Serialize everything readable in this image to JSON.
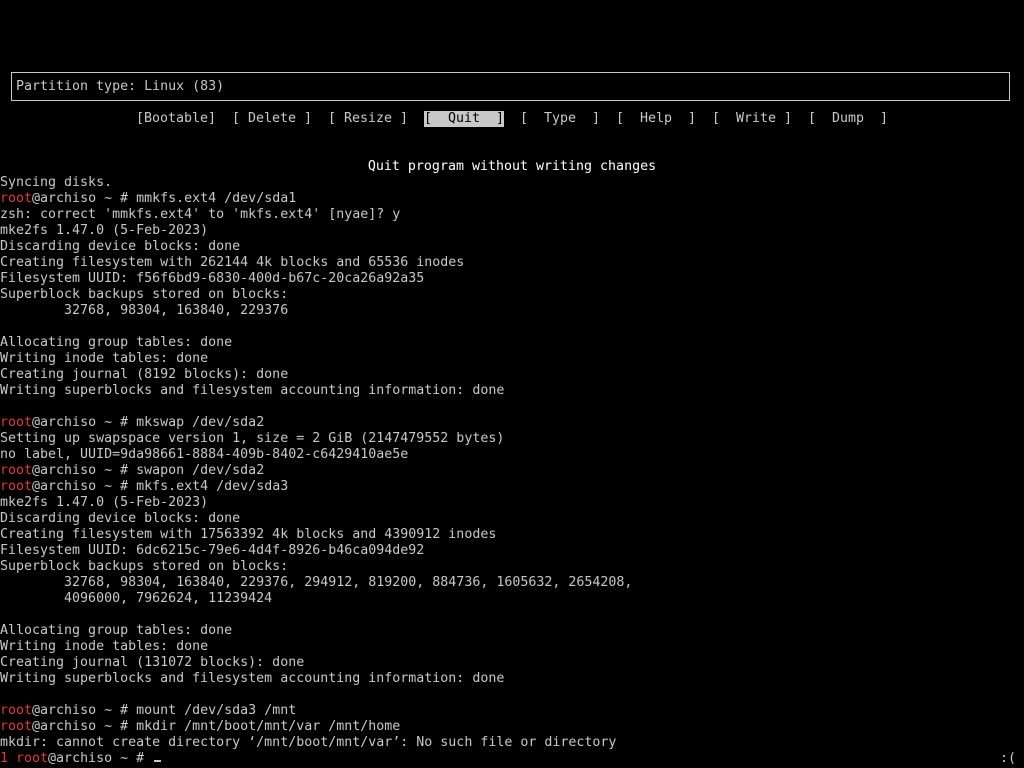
{
  "partition_box": {
    "text": "Partition type: Linux (83)"
  },
  "menu": {
    "items": [
      {
        "label": "[Bootable]"
      },
      {
        "label": "[ Delete ]"
      },
      {
        "label": "[ Resize ]"
      },
      {
        "label": "[  Quit  ]",
        "selected": true
      },
      {
        "label": "[  Type  ]"
      },
      {
        "label": "[  Help  ]"
      },
      {
        "label": "[  Write ]"
      },
      {
        "label": "[  Dump  ]"
      }
    ],
    "hint": "Quit program without writing changes"
  },
  "terminal": {
    "prompt_user": "root",
    "prompt_host": "@archiso ~ # ",
    "lines": [
      {
        "text": "Syncing disks."
      },
      {
        "prompt": true,
        "cmd": "mmkfs.ext4 /dev/sda1"
      },
      {
        "text": "zsh: correct 'mmkfs.ext4' to 'mkfs.ext4' [nyae]? y"
      },
      {
        "text": "mke2fs 1.47.0 (5-Feb-2023)"
      },
      {
        "text": "Discarding device blocks: done"
      },
      {
        "text": "Creating filesystem with 262144 4k blocks and 65536 inodes"
      },
      {
        "text": "Filesystem UUID: f56f6bd9-6830-400d-b67c-20ca26a92a35"
      },
      {
        "text": "Superblock backups stored on blocks:"
      },
      {
        "text": "\t32768, 98304, 163840, 229376"
      },
      {
        "text": ""
      },
      {
        "text": "Allocating group tables: done"
      },
      {
        "text": "Writing inode tables: done"
      },
      {
        "text": "Creating journal (8192 blocks): done"
      },
      {
        "text": "Writing superblocks and filesystem accounting information: done"
      },
      {
        "text": ""
      },
      {
        "prompt": true,
        "cmd": "mkswap /dev/sda2"
      },
      {
        "text": "Setting up swapspace version 1, size = 2 GiB (2147479552 bytes)"
      },
      {
        "text": "no label, UUID=9da98661-8884-409b-8402-c6429410ae5e"
      },
      {
        "prompt": true,
        "cmd": "swapon /dev/sda2"
      },
      {
        "prompt": true,
        "cmd": "mkfs.ext4 /dev/sda3"
      },
      {
        "text": "mke2fs 1.47.0 (5-Feb-2023)"
      },
      {
        "text": "Discarding device blocks: done"
      },
      {
        "text": "Creating filesystem with 17563392 4k blocks and 4390912 inodes"
      },
      {
        "text": "Filesystem UUID: 6dc6215c-79e6-4d4f-8926-b46ca094de92"
      },
      {
        "text": "Superblock backups stored on blocks:"
      },
      {
        "text": "\t32768, 98304, 163840, 229376, 294912, 819200, 884736, 1605632, 2654208,"
      },
      {
        "text": "\t4096000, 7962624, 11239424"
      },
      {
        "text": ""
      },
      {
        "text": "Allocating group tables: done"
      },
      {
        "text": "Writing inode tables: done"
      },
      {
        "text": "Creating journal (131072 blocks): done"
      },
      {
        "text": "Writing superblocks and filesystem accounting information: done"
      },
      {
        "text": ""
      },
      {
        "prompt": true,
        "cmd": "mount /dev/sda3 /mnt"
      },
      {
        "prompt": true,
        "cmd": "mkdir /mnt/boot/mnt/var /mnt/home"
      },
      {
        "text": "mkdir: cannot create directory ‘/mnt/boot/mnt/var’: No such file or directory"
      }
    ],
    "last_prompt_prefix": "1 ",
    "status_right": ":("
  },
  "colors": {
    "background": "#000000",
    "foreground": "#c8c8c8",
    "prompt_user": "#e0392e"
  }
}
